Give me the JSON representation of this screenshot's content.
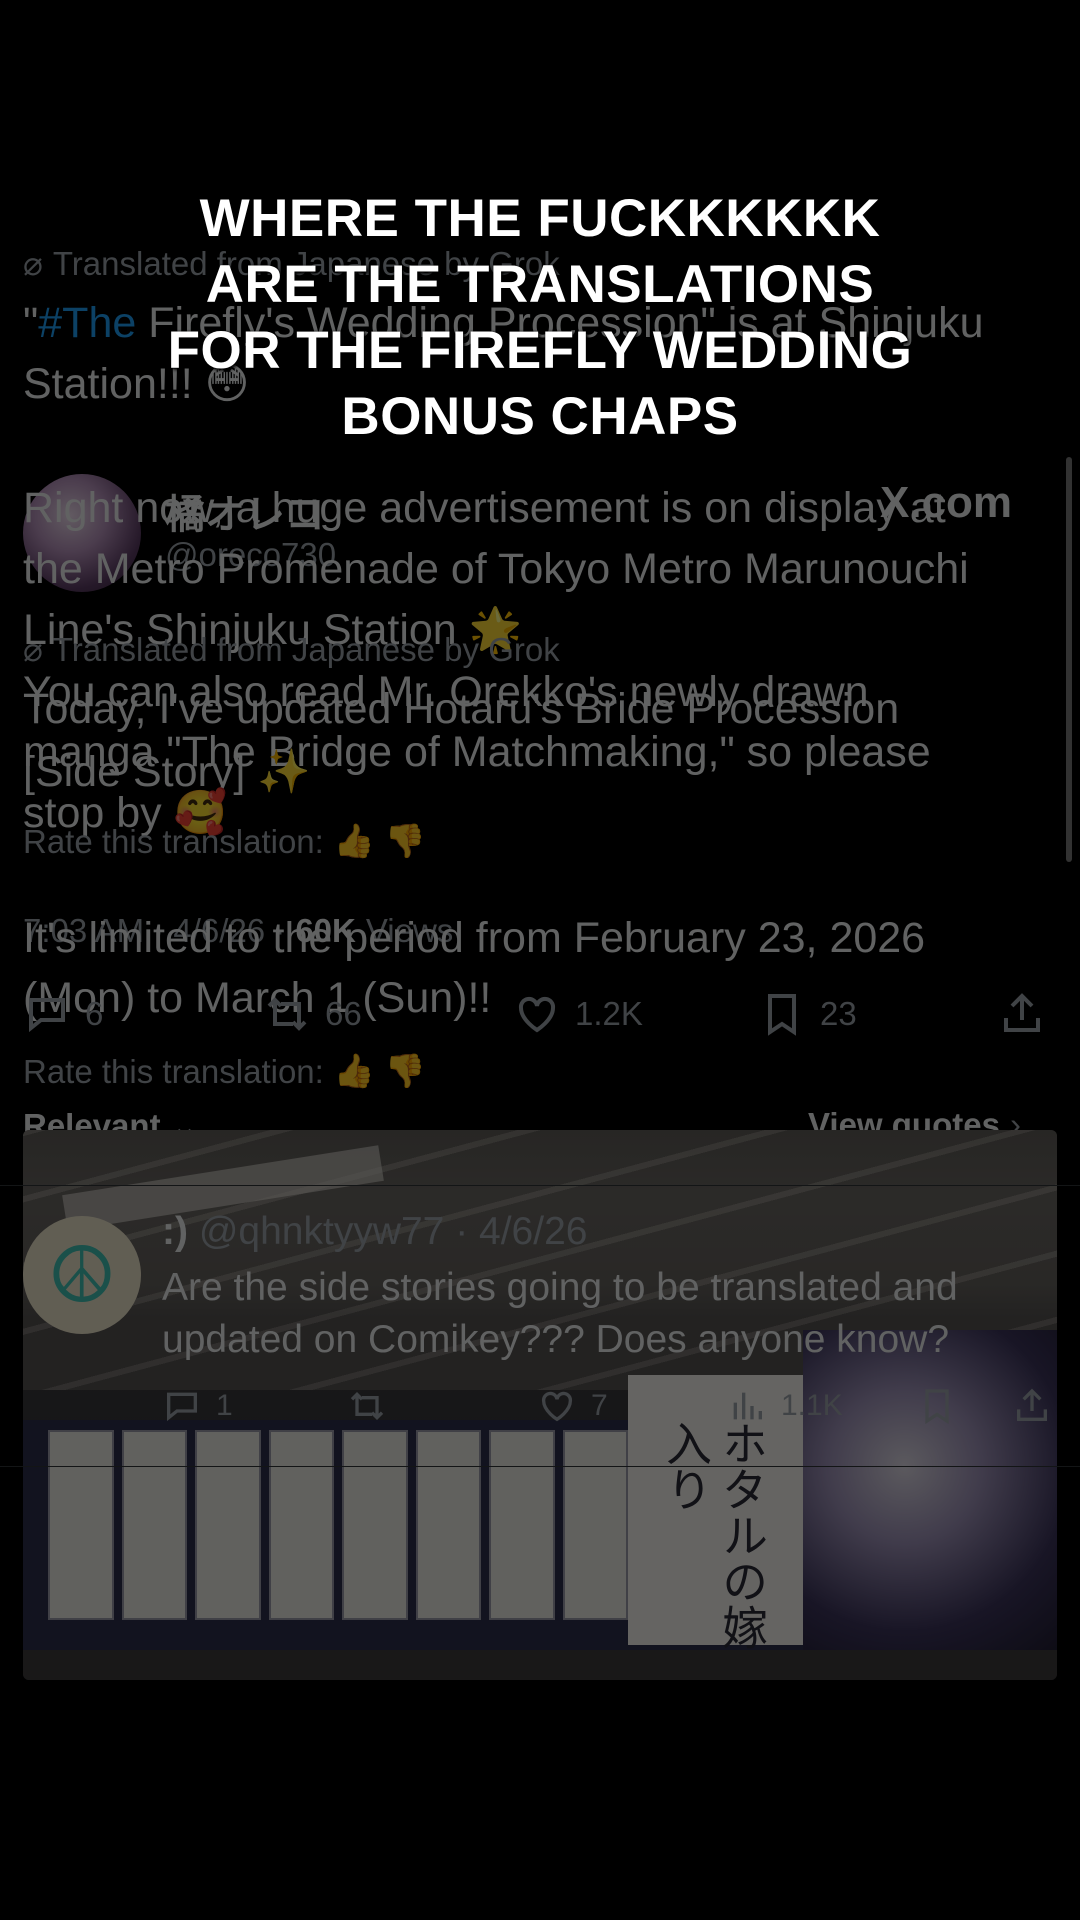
{
  "caption": {
    "line1": "WHERE THE FUCKKKKKK",
    "line2": "ARE THE TRANSLATIONS",
    "line3": "FOR THE FIREFLY WEDDING",
    "line4": "BONUS CHAPS"
  },
  "main_tweet": {
    "translated_note": "Translated from Japanese by Grok",
    "translated_note_2": "Translated from Japanese by Grok",
    "text_hashtag": "#The",
    "text_line1_rest": " Firefly's Wedding Procession\" is at Shinjuku",
    "text_line1_prefix": "\"",
    "text_line2": "Station!!! 😳",
    "text_line3": "Right now, a huge advertisement is on display at",
    "text_line4": "the Metro Promenade of Tokyo Metro Marunouchi",
    "text_line5": "Line's Shinjuku Station 🌟",
    "text_line6": "You can also read Mr. Orekko's newly drawn",
    "text_line7": "manga \"The Bridge of Matchmaking,\" so please",
    "text_line8": "stop by 🥰",
    "text_line9": "It's limited to the period from February 23, 2026",
    "text_line10": "(Mon) to March 1 (Sun)!!",
    "overlap_line1": "Today, I've updated Hotaru's Bride Procession",
    "overlap_line2": "[Side Story] ✨",
    "author_name": "橘オレコ",
    "author_handle": "@oreco730",
    "xcom": "X.com",
    "rate_label": "Rate this translation:",
    "rate_label_2": "Rate this translation:",
    "timestamp": "7:03 AM · 4/6/26 ·",
    "views_count": "60K",
    "views_label": "Views",
    "replies": "6",
    "reposts": "66",
    "likes": "1.2K",
    "bookmarks": "23"
  },
  "sort": {
    "relevant_label": "Relevant",
    "view_quotes_label": "View quotes"
  },
  "reply": {
    "name": ":)",
    "handle_date": "@qhnktyyw77 · 4/6/26",
    "text": "Are the side stories going to be translated and updated on Comikey??? Does anyone know?",
    "replies": "1",
    "likes": "7",
    "views": "1.1K"
  },
  "photo": {
    "poster_title": "ホタルの嫁入り"
  },
  "colors": {
    "background": "#000000",
    "text": "#e7e9ea",
    "muted": "#9aa0a6",
    "link": "#1d9bf0",
    "caption": "#ffffff"
  }
}
